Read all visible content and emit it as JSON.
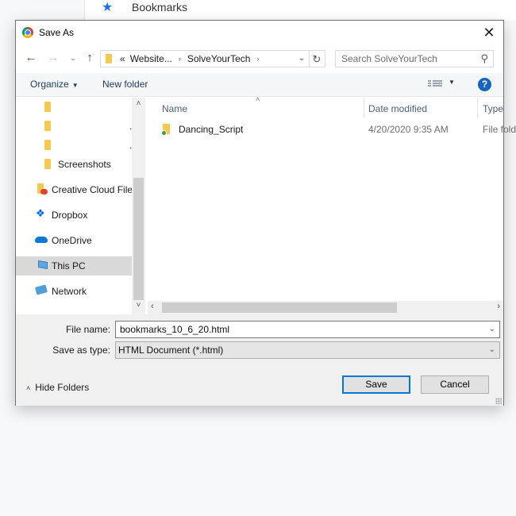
{
  "background": {
    "bookmarks_label": "Bookmarks",
    "accent": "#1a73e8"
  },
  "dialog": {
    "title": "Save As",
    "close_glyph": "✕",
    "nav": {
      "back_glyph": "←",
      "forward_glyph": "→",
      "recent_glyph": "⌄",
      "up_glyph": "↑",
      "address": {
        "overflow": "«",
        "crumbs": [
          "Website...",
          "SolveYourTech"
        ],
        "separator": "›",
        "dropdown_glyph": "⌄",
        "refresh_glyph": "↻"
      },
      "search": {
        "placeholder": "Search SolveYourTech",
        "icon_glyph": "⚲"
      }
    },
    "commandbar": {
      "organize_label": "Organize",
      "organize_arrow": "▼",
      "new_folder_label": "New folder",
      "view_arrow": "▼",
      "help_glyph": "?"
    },
    "navpane": {
      "items": [
        {
          "label": "",
          "icon": "folder-icon",
          "trailing": ""
        },
        {
          "label": "",
          "icon": "folder-icon",
          "trailing": "."
        },
        {
          "label": "",
          "icon": "folder-icon",
          "trailing": "."
        },
        {
          "label": "Screenshots",
          "icon": "folder-icon",
          "trailing": ""
        },
        {
          "label": "Creative Cloud Files",
          "icon": "creative-cloud-icon",
          "trailing": ""
        },
        {
          "label": "Dropbox",
          "icon": "dropbox-icon",
          "trailing": ""
        },
        {
          "label": "OneDrive",
          "icon": "onedrive-icon",
          "trailing": ""
        },
        {
          "label": "This PC",
          "icon": "computer-icon",
          "trailing": "",
          "selected": true
        },
        {
          "label": "Network",
          "icon": "network-icon",
          "trailing": ""
        }
      ],
      "scroll_up_glyph": "˄",
      "scroll_down_glyph": "˅"
    },
    "filelist": {
      "sort_glyph": "˄",
      "columns": [
        "Name",
        "Date modified",
        "Type"
      ],
      "rows": [
        {
          "name": "Dancing_Script",
          "date_modified": "4/20/2020 9:35 AM",
          "type": "File folder"
        }
      ],
      "scroll_left_glyph": "‹",
      "scroll_right_glyph": "›"
    },
    "form": {
      "file_name_label": "File name:",
      "file_name_value": "bookmarks_10_6_20.html",
      "save_as_type_label": "Save as type:",
      "save_as_type_value": "HTML Document (*.html)",
      "dropdown_glyph": "⌄"
    },
    "footer": {
      "hide_folders_glyph": "˄",
      "hide_folders_label": "Hide Folders",
      "save_label": "Save",
      "cancel_label": "Cancel"
    }
  }
}
